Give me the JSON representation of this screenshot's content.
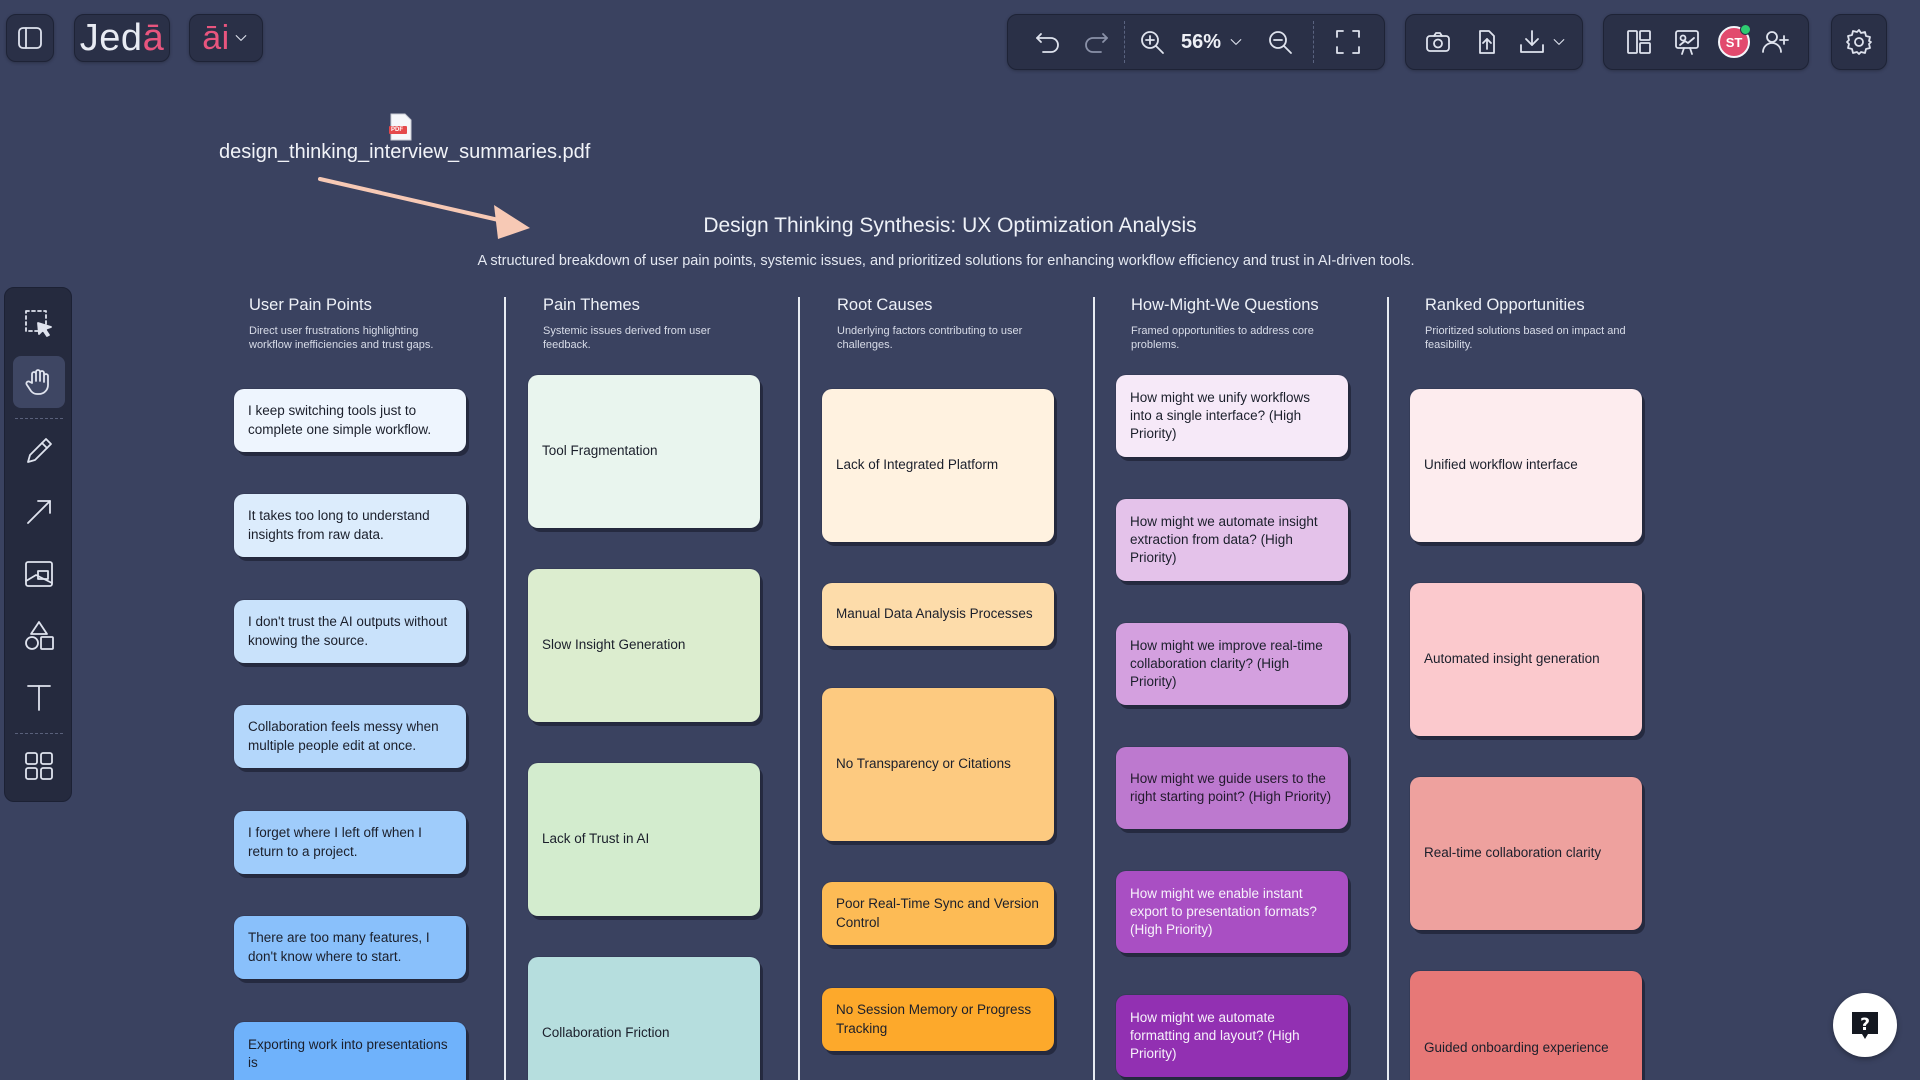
{
  "app": {
    "logo_main": "Jed",
    "logo_accent": "ā",
    "ai_label": "āi",
    "zoom": "56%",
    "avatar_initials": "ST",
    "colors": {
      "accent": "#e8557e",
      "canvas": "#3a4260",
      "toolbar": "#2a3047",
      "presence": "#2ecc71"
    }
  },
  "toolbar": {
    "undo_icon": "undo-icon",
    "redo_icon": "redo-icon",
    "zoom_in_icon": "zoom-in-icon",
    "zoom_out_icon": "zoom-out-icon",
    "fit_icon": "fit-screen-icon",
    "camera_icon": "camera-icon",
    "upload_icon": "upload-icon",
    "download_icon": "download-icon",
    "layout_icon": "layout-icon",
    "present_icon": "presentation-icon",
    "add_user_icon": "add-user-icon",
    "settings_icon": "gear-icon"
  },
  "left_tools": [
    "select-icon",
    "hand-icon",
    "pencil-icon",
    "arrow-icon",
    "image-icon",
    "shapes-icon",
    "text-icon",
    "apps-icon"
  ],
  "file": {
    "name": "design_thinking_interview_summaries.pdf",
    "badge": "PDF"
  },
  "board": {
    "title": "Design Thinking Synthesis: UX Optimization Analysis",
    "subtitle": "A structured breakdown of user pain points, systemic issues, and prioritized solutions for enhancing workflow efficiency and trust in AI-driven tools."
  },
  "columns": [
    {
      "title": "User Pain Points",
      "desc": "Direct user frustrations highlighting workflow inefficiencies and trust gaps.",
      "cards": [
        "I keep switching tools just to complete one simple workflow.",
        "It takes too long to understand insights from raw data.",
        "I don't trust the AI outputs without knowing the source.",
        "Collaboration feels messy when multiple people edit at once.",
        "I forget where I left off when I return to a project.",
        "There are too many features, I don't know where to start.",
        "Exporting work into presentations is"
      ]
    },
    {
      "title": "Pain Themes",
      "desc": "Systemic issues derived from user feedback.",
      "cards": [
        "Tool Fragmentation",
        "Slow Insight Generation",
        "Lack of Trust in AI",
        "Collaboration Friction"
      ]
    },
    {
      "title": "Root Causes",
      "desc": "Underlying factors contributing to user challenges.",
      "cards": [
        "Lack of Integrated Platform",
        "Manual Data Analysis Processes",
        "No Transparency or Citations",
        "Poor Real-Time Sync and Version Control",
        "No Session Memory or Progress Tracking"
      ]
    },
    {
      "title": "How-Might-We Questions",
      "desc": "Framed opportunities to address core problems.",
      "cards": [
        "How might we unify workflows into a single interface? (High Priority)",
        "How might we automate insight extraction from data? (High Priority)",
        "How might we improve real-time collaboration clarity? (High Priority)",
        "How might we guide users to the right starting point? (High Priority)",
        "How might we enable instant export to presentation formats? (High Priority)",
        "How might we automate formatting and layout? (High Priority)"
      ]
    },
    {
      "title": "Ranked Opportunities",
      "desc": "Prioritized solutions based on impact and feasibility.",
      "cards": [
        "Unified workflow interface",
        "Automated insight generation",
        "Real-time collaboration clarity",
        "Guided onboarding experience"
      ]
    }
  ],
  "help": {
    "icon": "help-icon"
  }
}
